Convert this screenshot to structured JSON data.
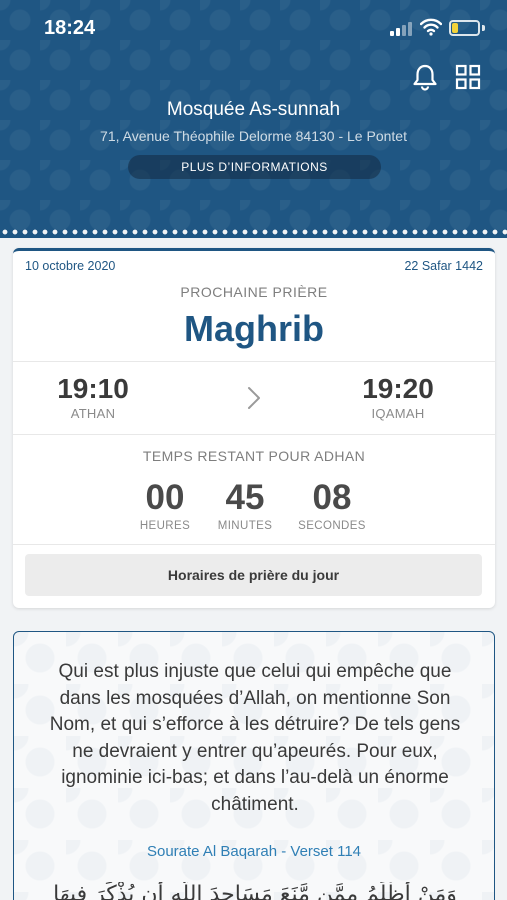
{
  "status_bar": {
    "time": "18:24"
  },
  "header": {
    "mosque_name": "Mosquée As-sunnah",
    "address": "71, Avenue Théophile Delorme 84130 - Le Pontet",
    "info_button": "PLUS D’INFORMATIONS",
    "icons": [
      "bell-icon",
      "grid-icon"
    ]
  },
  "prayer_card": {
    "gregorian_date": "10 octobre 2020",
    "hijri_date": "22 Safar 1442",
    "next_label": "PROCHAINE PRIÈRE",
    "next_prayer": "Maghrib",
    "athan_time": "19:10",
    "athan_label": "ATHAN",
    "iqamah_time": "19:20",
    "iqamah_label": "IQAMAH",
    "remaining_label": "TEMPS RESTANT POUR ADHAN",
    "countdown": {
      "hours": "00",
      "hours_label": "HEURES",
      "minutes": "45",
      "minutes_label": "MINUTES",
      "seconds": "08",
      "seconds_label": "SECONDES"
    },
    "day_schedule_button": "Horaires de prière du jour"
  },
  "verse_card": {
    "text": "Qui est plus injuste que celui qui empêche que dans les mosquées d’Allah, on mentionne Son Nom, et qui s’efforce à les détruire? De tels gens ne devraient y entrer qu’apeurés. Pour eux, ignominie ici-bas; et dans l’au-delà un énorme châtiment.",
    "reference": "Sourate Al Baqarah - Verset 114",
    "arabic": "وَمَنْ أَظْلَمُ مِمَّن مَّنَعَ مَسَاجِدَ اللَّهِ أَن يُذْكَرَ فِيهَا"
  },
  "colors": {
    "brand": "#1f5683",
    "link": "#2f7fb5",
    "battery": "#f2d23a"
  }
}
